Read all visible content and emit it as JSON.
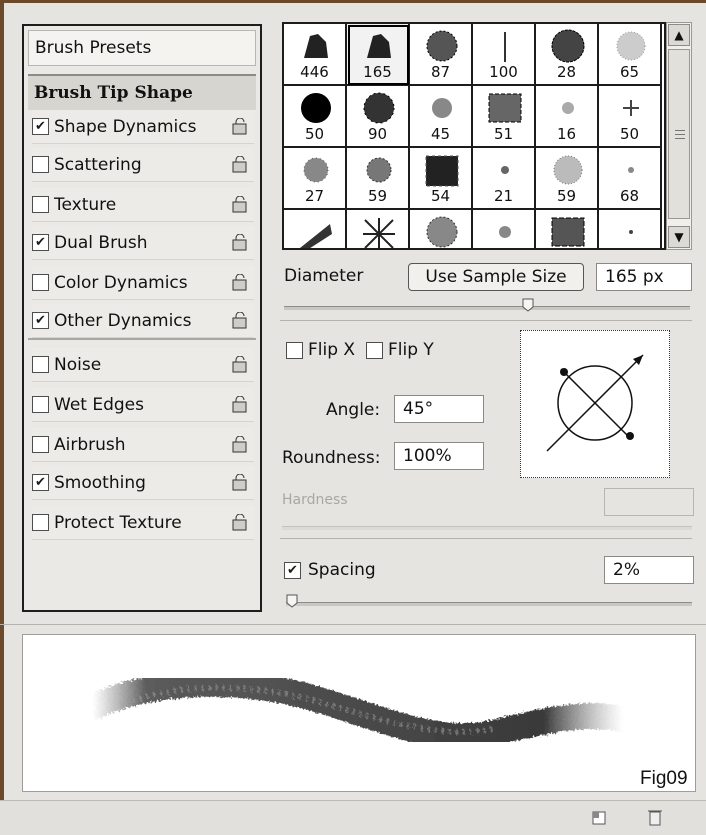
{
  "sidebar": {
    "presets": "Brush Presets",
    "tip_shape": "Brush Tip Shape",
    "items": [
      {
        "label": "Shape Dynamics",
        "checked": true
      },
      {
        "label": "Scattering",
        "checked": false
      },
      {
        "label": "Texture",
        "checked": false
      },
      {
        "label": "Dual Brush",
        "checked": true
      },
      {
        "label": "Color Dynamics",
        "checked": false
      },
      {
        "label": "Other Dynamics",
        "checked": true
      },
      {
        "label": "Noise",
        "checked": false
      },
      {
        "label": "Wet Edges",
        "checked": false
      },
      {
        "label": "Airbrush",
        "checked": false
      },
      {
        "label": "Smoothing",
        "checked": true
      },
      {
        "label": "Protect Texture",
        "checked": false
      }
    ]
  },
  "brushes": [
    "446",
    "165",
    "87",
    "100",
    "28",
    "65",
    "50",
    "90",
    "45",
    "51",
    "16",
    "50",
    "27",
    "59",
    "54",
    "21",
    "59",
    "68",
    "",
    "",
    "",
    "",
    "",
    ""
  ],
  "selected_brush_index": 1,
  "diameter": {
    "label": "Diameter",
    "button": "Use Sample Size",
    "value": "165 px",
    "slider_fraction": 0.6
  },
  "flip": {
    "x_label": "Flip X",
    "y_label": "Flip Y",
    "x": false,
    "y": false
  },
  "angle": {
    "label": "Angle:",
    "value": "45°"
  },
  "roundness": {
    "label": "Roundness:",
    "value": "100%"
  },
  "hardness": {
    "label": "Hardness",
    "value": ""
  },
  "spacing": {
    "label": "Spacing",
    "checked": true,
    "value": "2%",
    "slider_fraction": 0.0
  },
  "caption": "Fig09",
  "colors": {
    "frame": "#6b4a2b",
    "panel": "#ebe9e5"
  }
}
